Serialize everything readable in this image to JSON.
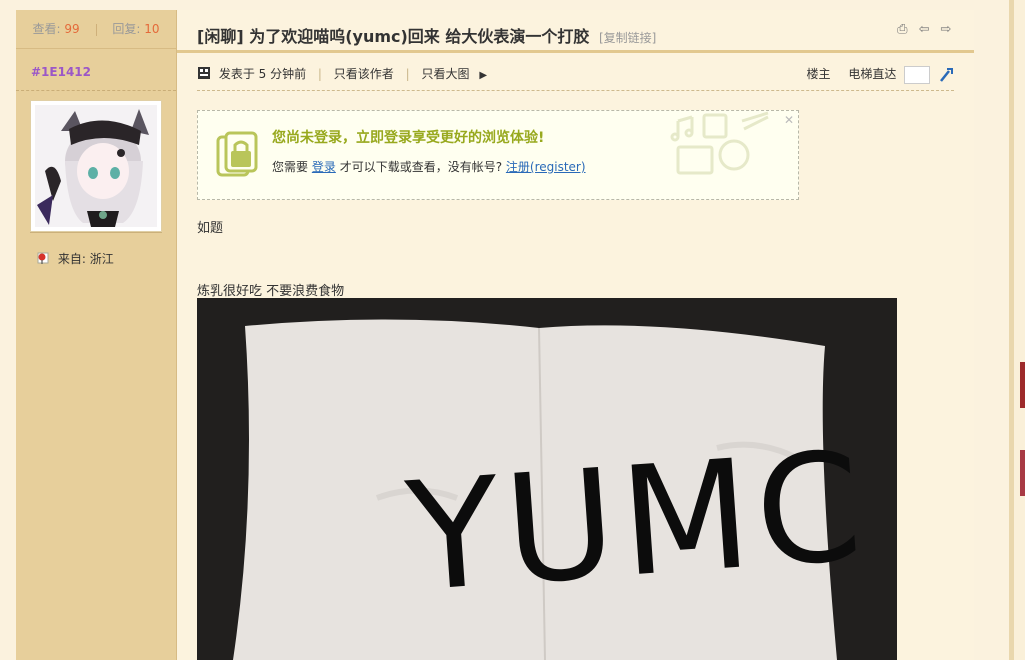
{
  "stats": {
    "views_label": "查看:",
    "views": "99",
    "replies_label": "回复:",
    "replies": "10"
  },
  "user": {
    "uid": "#1E1412",
    "from_label": "来自:",
    "location": "浙江"
  },
  "thread": {
    "title": "[闲聊] 为了欢迎喵呜(yumc)回来 给大伙表演一个打胶",
    "copy_link": "[复制链接]"
  },
  "postinfo": {
    "posted": "发表于 5 分钟前",
    "author_only": "只看该作者",
    "big_images": "只看大图",
    "floor": "楼主",
    "elevator": "电梯直达"
  },
  "login_notice": {
    "heading": "您尚未登录，立即登录享受更好的浏览体验!",
    "prefix": "您需要",
    "login": "登录",
    "middle": "才可以下载或查看，没有帐号?",
    "register": "注册(register)"
  },
  "post": {
    "line1": "如题",
    "line2": "炼乳很好吃 不要浪费食物",
    "image_text": "YUMC"
  },
  "colors": {
    "sidebar": "#e7cf9b",
    "accent_green": "#98a91e",
    "uid_purple": "#9b57c7",
    "link": "#2a6ab8",
    "count": "#e46a3a"
  }
}
